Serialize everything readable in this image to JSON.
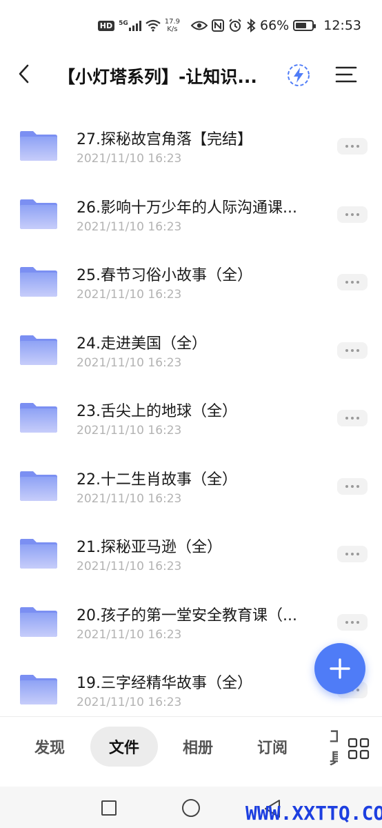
{
  "status_bar": {
    "hd_badge": "HD",
    "net_type": "5G",
    "speed_value": "17.9",
    "speed_unit": "K/s",
    "battery": "66%",
    "battery_level": 0.66,
    "time": "12:53"
  },
  "header": {
    "title": "【小灯塔系列】-让知识..."
  },
  "files": [
    {
      "name": "27.探秘故宫角落【完结】",
      "date": "2021/11/10 16:23"
    },
    {
      "name": "26.影响十万少年的人际沟通课...",
      "date": "2021/11/10 16:23"
    },
    {
      "name": "25.春节习俗小故事（全）",
      "date": "2021/11/10 16:23"
    },
    {
      "name": "24.走进美国（全）",
      "date": "2021/11/10 16:23"
    },
    {
      "name": "23.舌尖上的地球（全）",
      "date": "2021/11/10 16:23"
    },
    {
      "name": "22.十二生肖故事（全）",
      "date": "2021/11/10 16:23"
    },
    {
      "name": "21.探秘亚马逊（全）",
      "date": "2021/11/10 16:23"
    },
    {
      "name": "20.孩子的第一堂安全教育课（...",
      "date": "2021/11/10 16:23"
    },
    {
      "name": "19.三字经精华故事（全）",
      "date": "2021/11/10 16:23"
    }
  ],
  "tabs": [
    {
      "label": "发现"
    },
    {
      "label": "文件"
    },
    {
      "label": "相册"
    },
    {
      "label": "订阅"
    },
    {
      "label": "工具"
    }
  ],
  "watermark": "WWW.XXTTQ.COM",
  "colors": {
    "accent": "#4f7cf7",
    "folder_top": "#8ea2f5",
    "folder_bottom": "#c7cdfa",
    "date_gray": "#b3b3b3"
  }
}
